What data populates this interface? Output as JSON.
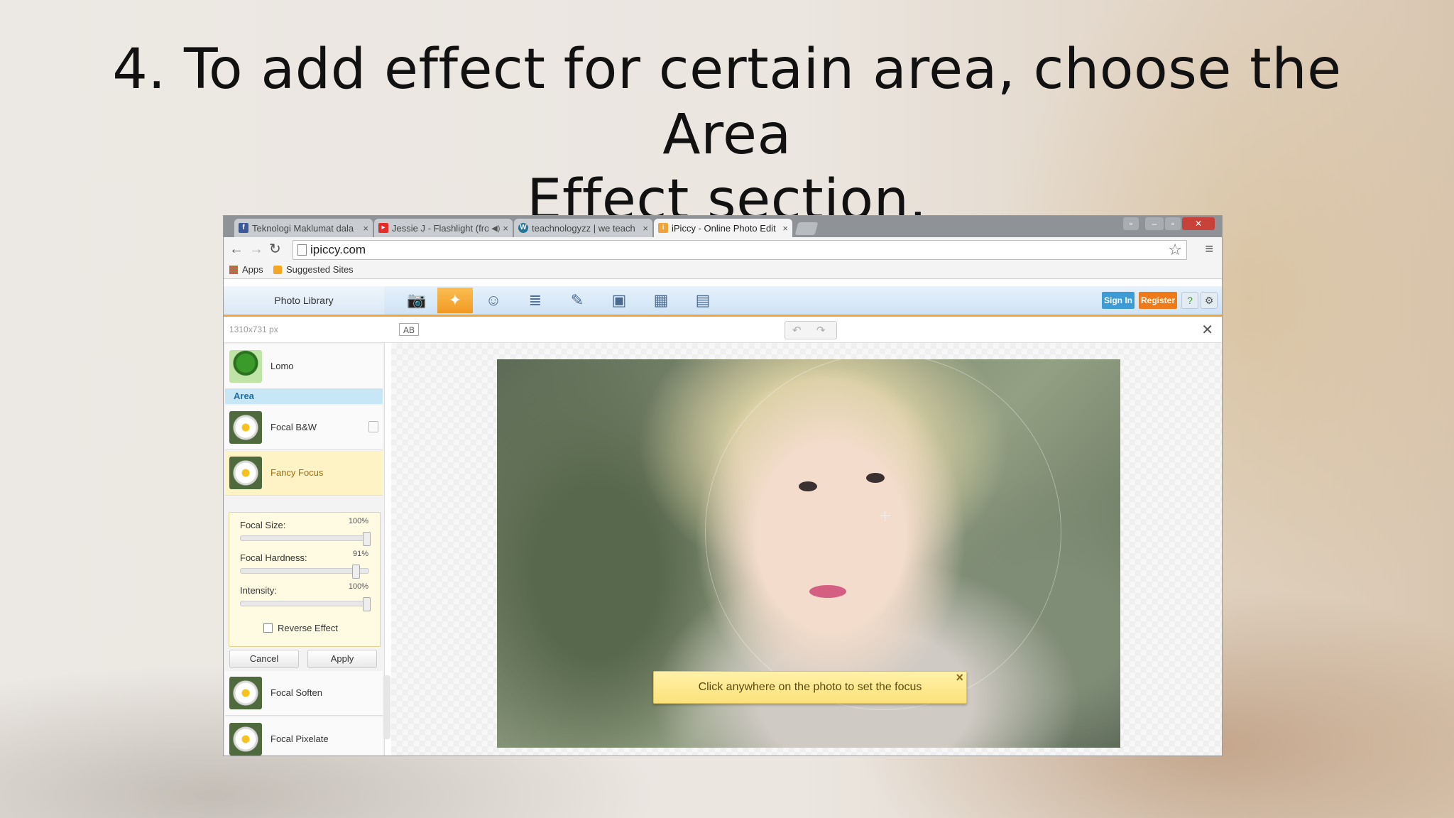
{
  "slide": {
    "title_line1": "4. To add effect for certain area, choose the Area",
    "title_line2": "Effect section."
  },
  "browser": {
    "tabs": [
      {
        "label": "Teknologi Maklumat dala",
        "favicon": "facebook-icon",
        "color": "#3b5998"
      },
      {
        "label": "Jessie J - Flashlight (fro",
        "favicon": "youtube-icon",
        "color": "#e52d27"
      },
      {
        "label": "teachnologyzz | we teach",
        "favicon": "wordpress-icon",
        "color": "#21759b"
      },
      {
        "label": "iPiccy - Online Photo Edit",
        "favicon": "ipiccy-icon",
        "color": "#f0a53c"
      }
    ],
    "url": "ipiccy.com",
    "bookmarks": {
      "apps": "Apps",
      "suggested": "Suggested Sites"
    }
  },
  "app": {
    "photo_library": "Photo Library",
    "tools": [
      "camera-icon",
      "magic-wand-icon",
      "person-icon",
      "layers-icon",
      "paint-icon",
      "frame-icon",
      "texture-icon",
      "save-icon"
    ],
    "sign_in": "Sign In",
    "register": "Register",
    "image_dims": "1310x731 px",
    "ab_label": "AB",
    "effects": {
      "lomo": "Lomo",
      "area_header": "Area",
      "focal_bw": "Focal B&W",
      "fancy_focus": "Fancy Focus",
      "focal_soften": "Focal Soften",
      "focal_pixelate": "Focal Pixelate"
    },
    "settings": {
      "focal_size_label": "Focal Size:",
      "focal_size_value": "100%",
      "focal_size_level": 1.0,
      "focal_hardness_label": "Focal Hardness:",
      "focal_hardness_value": "91%",
      "focal_hardness_level": 0.91,
      "intensity_label": "Intensity:",
      "intensity_value": "100%",
      "intensity_level": 1.0,
      "reverse_effect": "Reverse Effect",
      "reverse_checked": false
    },
    "cancel": "Cancel",
    "apply": "Apply",
    "tooltip": "Click anywhere on the photo to set the focus",
    "colors": {
      "accent": "#f0a53c",
      "signin": "#3d9bd6",
      "register": "#ef7a1a"
    }
  }
}
